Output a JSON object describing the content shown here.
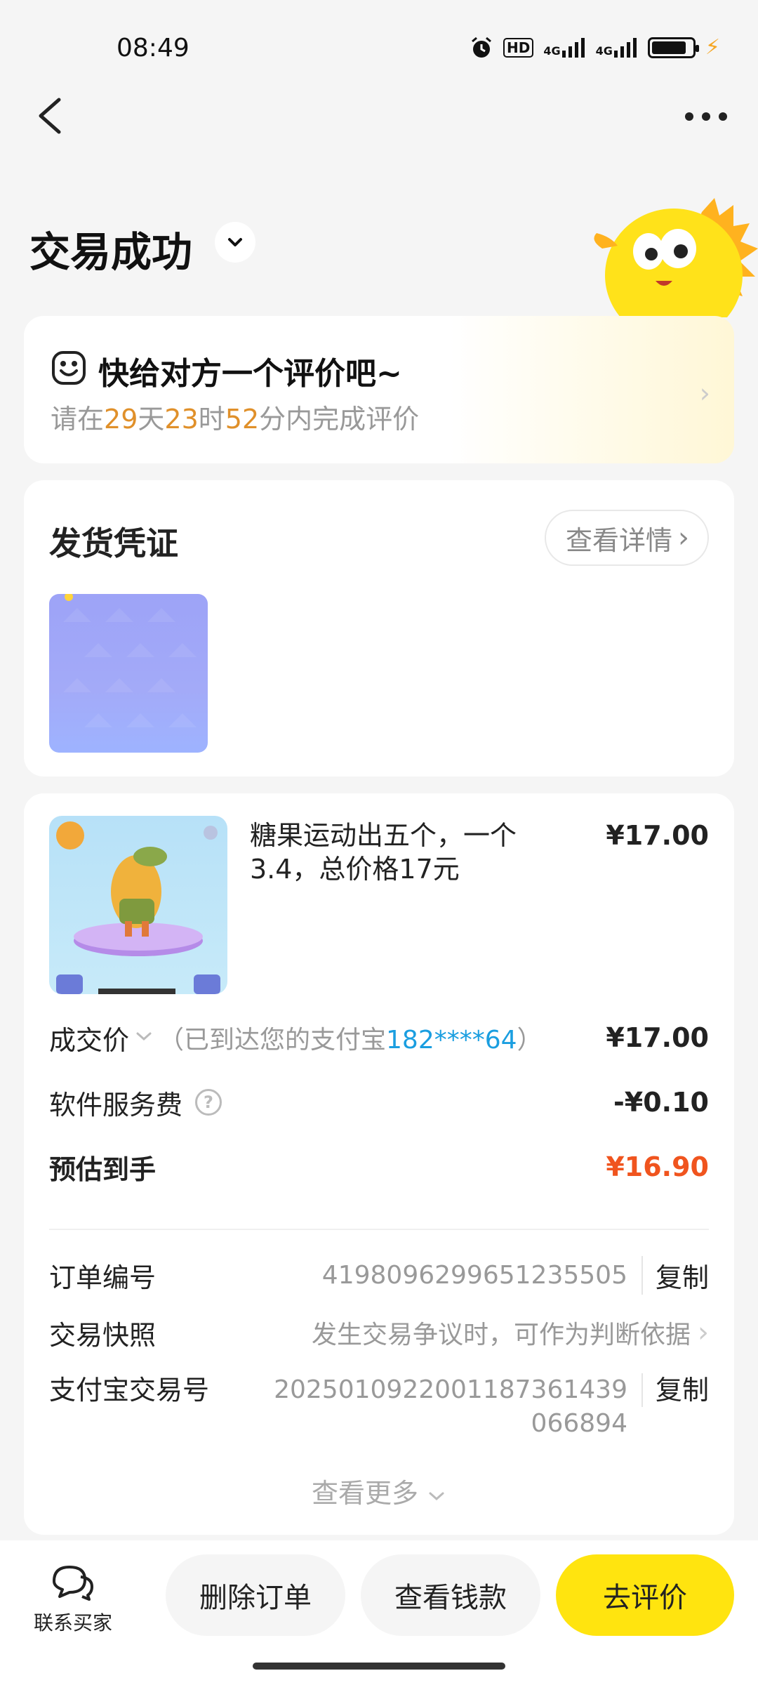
{
  "status_bar": {
    "time": "08:49",
    "icons": [
      "alarm-icon",
      "hd-icon",
      "4g-signal-icon",
      "4g-signal-icon",
      "battery-icon",
      "charging-icon"
    ],
    "hd": "HD",
    "net1": "4G",
    "net2": "4G"
  },
  "nav": {
    "back_icon": "chevron-left-icon",
    "more_icon": "more-dots-icon"
  },
  "header": {
    "title": "交易成功",
    "dropdown_icon": "chevron-down-icon"
  },
  "review_card": {
    "title": "快给对方一个评价吧~",
    "sub_prefix": "请在",
    "days": "29",
    "days_unit": "天",
    "hours": "23",
    "hours_unit": "时",
    "minutes": "52",
    "minutes_suffix": "分内完成评价",
    "highlight_color": "#e0902a"
  },
  "proof_card": {
    "title": "发货凭证",
    "detail_button": "查看详情"
  },
  "order_card": {
    "product_name": "糖果运动出五个，一个3.4，总价格17元",
    "product_price": "¥17.00",
    "deal_price_label": "成交价",
    "deal_price_note_prefix": "（已到达您的支付宝",
    "alipay_account": "182****64",
    "deal_price_note_suffix": "）",
    "deal_price": "¥17.00",
    "service_fee_label": "软件服务费",
    "service_fee": "-¥0.10",
    "estimated_label": "预估到手",
    "estimated_value": "¥16.90",
    "order_no_label": "订单编号",
    "order_no": "4198096299651235505",
    "copy_label": "复制",
    "snapshot_label": "交易快照",
    "snapshot_value": "发生交易争议时，可作为判断依据",
    "alipay_trade_label": "支付宝交易号",
    "alipay_trade_line1": "2025010922001187361439",
    "alipay_trade_line2": "066894",
    "see_more": "查看更多"
  },
  "bottom_bar": {
    "contact_label": "联系买家",
    "delete_button": "删除订单",
    "money_button": "查看钱款",
    "review_button": "去评价",
    "accent_color": "#ffe40f"
  }
}
